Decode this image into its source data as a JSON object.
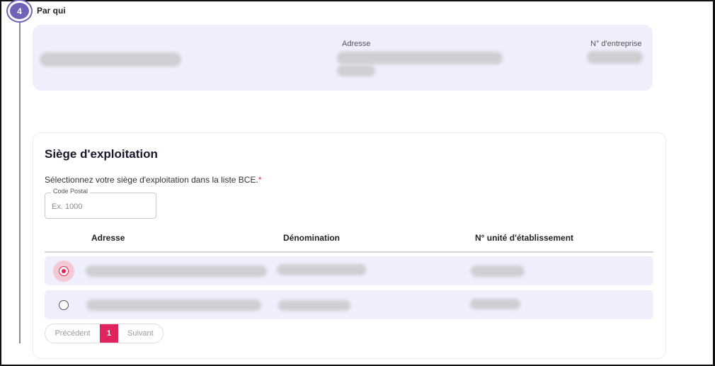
{
  "step": {
    "number": "4",
    "title": "Par qui"
  },
  "company": {
    "address_label": "Adresse",
    "enterprise_number_label": "N° d'entreprise"
  },
  "section": {
    "title": "Siège d'exploitation",
    "instruction": "Sélectionnez votre siège d'exploitation dans la liste BCE.",
    "required_mark": "*"
  },
  "postal_code": {
    "label": "Code Postal",
    "placeholder": "Ex. 1000",
    "value": ""
  },
  "table": {
    "columns": [
      "Adresse",
      "Dénomination",
      "N° unité d'établissement"
    ],
    "rows": [
      {
        "selected": true
      },
      {
        "selected": false
      }
    ]
  },
  "pagination": {
    "previous": "Précédent",
    "current": "1",
    "next": "Suivant"
  },
  "colors": {
    "accent": "#e0245e",
    "step": "#6f63b8",
    "card_background": "#efeefc"
  }
}
